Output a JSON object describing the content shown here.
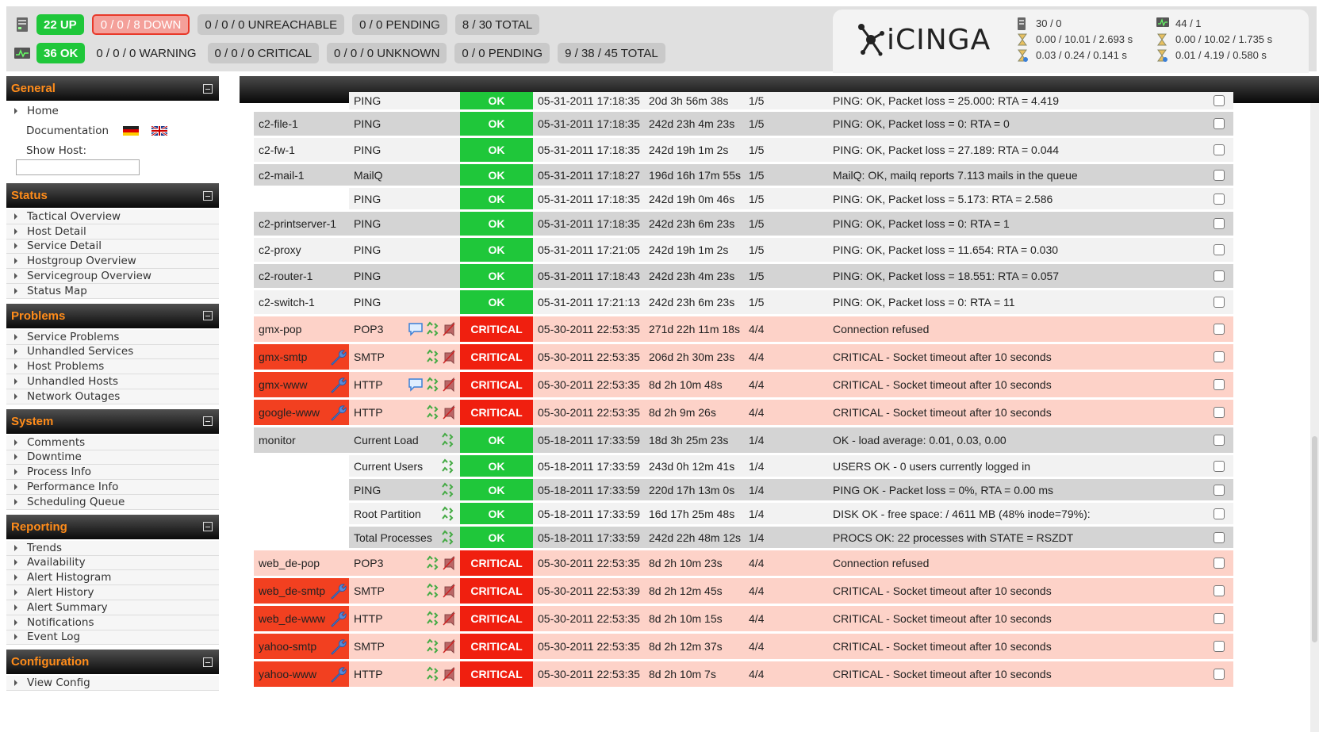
{
  "status_bar": {
    "hosts": {
      "up": "22 UP",
      "down": "0 / 0 / 8 DOWN",
      "unreachable": "0 / 0 / 0 UNREACHABLE",
      "pending": "0 / 0 PENDING",
      "total": "8 / 30 TOTAL"
    },
    "services": {
      "ok": "36 OK",
      "warning": "0 / 0 / 0 WARNING",
      "critical": "0 / 0 / 0 CRITICAL",
      "unknown": "0 / 0 / 0 UNKNOWN",
      "pending": "0 / 0 PENDING",
      "total": "9 / 38 / 45 TOTAL"
    }
  },
  "brand": {
    "logo_text": "iCINGA"
  },
  "perf": {
    "host_count": "30 / 0",
    "host_latency": "0.00 / 10.01 / 2.693 s",
    "host_exec": "0.03 / 0.24 / 0.141 s",
    "svc_count": "44 / 1",
    "svc_latency": "0.00 / 10.02 / 1.735 s",
    "svc_exec": "0.01 / 4.19 / 0.580 s"
  },
  "sidebar": {
    "general": {
      "title": "General",
      "home": "Home",
      "documentation": "Documentation",
      "show_host_label": "Show Host:",
      "show_host_value": ""
    },
    "status": {
      "title": "Status",
      "items": [
        "Tactical Overview",
        "Host Detail",
        "Service Detail",
        "Hostgroup Overview",
        "Servicegroup Overview",
        "Status Map"
      ]
    },
    "problems": {
      "title": "Problems",
      "items": [
        "Service Problems",
        "Unhandled Services",
        "Host Problems",
        "Unhandled Hosts",
        "Network Outages"
      ]
    },
    "system": {
      "title": "System",
      "items": [
        "Comments",
        "Downtime",
        "Process Info",
        "Performance Info",
        "Scheduling Queue"
      ]
    },
    "reporting": {
      "title": "Reporting",
      "items": [
        "Trends",
        "Availability",
        "Alert Histogram",
        "Alert History",
        "Alert Summary",
        "Notifications",
        "Event Log"
      ]
    },
    "configuration": {
      "title": "Configuration",
      "items": [
        "View Config"
      ]
    }
  },
  "colors": {
    "ok": "#1fc73a",
    "critical": "#f01f0f",
    "down_host": "#f24020",
    "critical_row": "#fdd2c8",
    "sidebar_head_text": "#ff8c1a"
  },
  "services": [
    {
      "host": "",
      "service": "PING",
      "status": "OK",
      "last_check": "05-31-2011 17:18:35",
      "duration": "20d 3h 56m 38s",
      "attempt": "1/5",
      "info": "PING: OK, Packet loss = 25.000: RTA = 4.419",
      "cut": true
    },
    {
      "host": "c2-file-1",
      "service": "PING",
      "status": "OK",
      "last_check": "05-31-2011 17:18:35",
      "duration": "242d 23h 4m 23s",
      "attempt": "1/5",
      "info": "PING: OK, Packet loss = 0: RTA = 0"
    },
    {
      "host": "c2-fw-1",
      "service": "PING",
      "status": "OK",
      "last_check": "05-31-2011 17:18:35",
      "duration": "242d 19h 1m 2s",
      "attempt": "1/5",
      "info": "PING: OK, Packet loss = 27.189: RTA = 0.044"
    },
    {
      "host": "c2-mail-1",
      "service": "MailQ",
      "status": "OK",
      "last_check": "05-31-2011 17:18:27",
      "duration": "196d 16h 17m 55s",
      "attempt": "1/5",
      "info": "MailQ: OK, mailq reports 7.113 mails in the queue"
    },
    {
      "host": "",
      "service": "PING",
      "status": "OK",
      "last_check": "05-31-2011 17:18:35",
      "duration": "242d 19h 0m 46s",
      "attempt": "1/5",
      "info": "PING: OK, Packet loss = 5.173: RTA = 2.586"
    },
    {
      "host": "c2-printserver-1",
      "service": "PING",
      "status": "OK",
      "last_check": "05-31-2011 17:18:35",
      "duration": "242d 23h 6m 23s",
      "attempt": "1/5",
      "info": "PING: OK, Packet loss = 0: RTA = 1"
    },
    {
      "host": "c2-proxy",
      "service": "PING",
      "status": "OK",
      "last_check": "05-31-2011 17:21:05",
      "duration": "242d 19h 1m 2s",
      "attempt": "1/5",
      "info": "PING: OK, Packet loss = 11.654: RTA = 0.030"
    },
    {
      "host": "c2-router-1",
      "service": "PING",
      "status": "OK",
      "last_check": "05-31-2011 17:18:43",
      "duration": "242d 23h 4m 23s",
      "attempt": "1/5",
      "info": "PING: OK, Packet loss = 18.551: RTA = 0.057"
    },
    {
      "host": "c2-switch-1",
      "service": "PING",
      "status": "OK",
      "last_check": "05-31-2011 17:21:13",
      "duration": "242d 23h 6m 23s",
      "attempt": "1/5",
      "info": "PING: OK, Packet loss = 0: RTA = 11"
    },
    {
      "host": "gmx-pop",
      "service": "POP3",
      "status": "CRITICAL",
      "last_check": "05-30-2011 22:53:35",
      "duration": "271d 22h 11m 18s",
      "attempt": "4/4",
      "info": "Connection refused"
    },
    {
      "host": "gmx-smtp",
      "service": "SMTP",
      "status": "CRITICAL",
      "last_check": "05-30-2011 22:53:35",
      "duration": "206d 2h 30m 23s",
      "attempt": "4/4",
      "info": "CRITICAL - Socket timeout after 10 seconds"
    },
    {
      "host": "gmx-www",
      "service": "HTTP",
      "status": "CRITICAL",
      "last_check": "05-30-2011 22:53:35",
      "duration": "8d 2h 10m 48s",
      "attempt": "4/4",
      "info": "CRITICAL - Socket timeout after 10 seconds"
    },
    {
      "host": "google-www",
      "service": "HTTP",
      "status": "CRITICAL",
      "last_check": "05-30-2011 22:53:35",
      "duration": "8d 2h 9m 26s",
      "attempt": "4/4",
      "info": "CRITICAL - Socket timeout after 10 seconds"
    },
    {
      "host": "monitor",
      "service": "Current Load",
      "status": "OK",
      "last_check": "05-18-2011 17:33:59",
      "duration": "18d 3h 25m 23s",
      "attempt": "1/4",
      "info": "OK - load average: 0.01, 0.03, 0.00"
    },
    {
      "host": "",
      "service": "Current Users",
      "status": "OK",
      "last_check": "05-18-2011 17:33:59",
      "duration": "243d 0h 12m 41s",
      "attempt": "1/4",
      "info": "USERS OK - 0 users currently logged in"
    },
    {
      "host": "",
      "service": "PING",
      "status": "OK",
      "last_check": "05-18-2011 17:33:59",
      "duration": "220d 17h 13m 0s",
      "attempt": "1/4",
      "info": "PING OK - Packet loss = 0%, RTA = 0.00 ms"
    },
    {
      "host": "",
      "service": "Root Partition",
      "status": "OK",
      "last_check": "05-18-2011 17:33:59",
      "duration": "16d 17h 25m 48s",
      "attempt": "1/4",
      "info": "DISK OK - free space: / 4611 MB (48% inode=79%):"
    },
    {
      "host": "",
      "service": "Total Processes",
      "status": "OK",
      "last_check": "05-18-2011 17:33:59",
      "duration": "242d 22h 48m 12s",
      "attempt": "1/4",
      "info": "PROCS OK: 22 processes with STATE = RSZDT"
    },
    {
      "host": "web_de-pop",
      "service": "POP3",
      "status": "CRITICAL",
      "last_check": "05-30-2011 22:53:35",
      "duration": "8d 2h 10m 23s",
      "attempt": "4/4",
      "info": "Connection refused"
    },
    {
      "host": "web_de-smtp",
      "service": "SMTP",
      "status": "CRITICAL",
      "last_check": "05-30-2011 22:53:39",
      "duration": "8d 2h 12m 45s",
      "attempt": "4/4",
      "info": "CRITICAL - Socket timeout after 10 seconds"
    },
    {
      "host": "web_de-www",
      "service": "HTTP",
      "status": "CRITICAL",
      "last_check": "05-30-2011 22:53:35",
      "duration": "8d 2h 10m 15s",
      "attempt": "4/4",
      "info": "CRITICAL - Socket timeout after 10 seconds"
    },
    {
      "host": "yahoo-smtp",
      "service": "SMTP",
      "status": "CRITICAL",
      "last_check": "05-30-2011 22:53:35",
      "duration": "8d 2h 12m 37s",
      "attempt": "4/4",
      "info": "CRITICAL - Socket timeout after 10 seconds"
    },
    {
      "host": "yahoo-www",
      "service": "HTTP",
      "status": "CRITICAL",
      "last_check": "05-30-2011 22:53:35",
      "duration": "8d 2h 10m 7s",
      "attempt": "4/4",
      "info": "CRITICAL - Socket timeout after 10 seconds"
    }
  ]
}
